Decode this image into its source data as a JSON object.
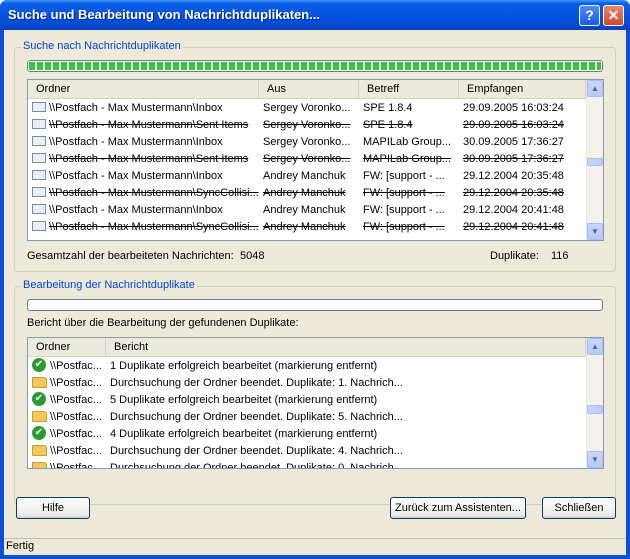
{
  "window": {
    "title": "Suche und Bearbeitung von Nachrichtduplikaten...",
    "help_glyph": "?",
    "close_glyph": "✕"
  },
  "search_group": {
    "legend": "Suche nach Nachrichtduplikaten",
    "progress_fraction": 1.0,
    "columns": [
      "Ordner",
      "Aus",
      "Betreff",
      "Empfangen"
    ],
    "rows": [
      {
        "folder": "\\\\Postfach - Max Mustermann\\Inbox",
        "from": "Sergey Voronko...",
        "subject": "SPE 1.8.4",
        "received": "29.09.2005 16:03:24",
        "duplicate": false
      },
      {
        "folder": "\\\\Postfach - Max Mustermann\\Sent Items",
        "from": "Sergey Voronko...",
        "subject": "SPE 1.8.4",
        "received": "29.09.2005 16:03:24",
        "duplicate": true
      },
      {
        "folder": "\\\\Postfach - Max Mustermann\\Inbox",
        "from": "Sergey Voronko...",
        "subject": "MAPILab Group...",
        "received": "30.09.2005 17:36:27",
        "duplicate": false
      },
      {
        "folder": "\\\\Postfach - Max Mustermann\\Sent Items",
        "from": "Sergey Voronko...",
        "subject": "MAPILab Group...",
        "received": "30.09.2005 17:36:27",
        "duplicate": true
      },
      {
        "folder": "\\\\Postfach - Max Mustermann\\Inbox",
        "from": "Andrey Manchuk",
        "subject": "FW: [support - ...",
        "received": "29.12.2004 20:35:48",
        "duplicate": false
      },
      {
        "folder": "\\\\Postfach - Max Mustermann\\SyncCollisi...",
        "from": "Andrey Manchuk",
        "subject": "FW: [support - ...",
        "received": "29.12.2004 20:35:48",
        "duplicate": true
      },
      {
        "folder": "\\\\Postfach - Max Mustermann\\Inbox",
        "from": "Andrey Manchuk",
        "subject": "FW: [support - ...",
        "received": "29.12.2004 20:41:48",
        "duplicate": false
      },
      {
        "folder": "\\\\Postfach - Max Mustermann\\SyncCollisi...",
        "from": "Andrey Manchuk",
        "subject": "FW: [support - ...",
        "received": "29.12.2004 20:41:48",
        "duplicate": true
      }
    ],
    "total_label": "Gesamtzahl der bearbeiteten Nachrichten:",
    "total_value": "5048",
    "duplicates_label": "Duplikate:",
    "duplicates_value": "116"
  },
  "processing_group": {
    "legend": "Bearbeitung der Nachrichtduplikate",
    "progress_fraction": 0.0,
    "report_label": "Bericht über die Bearbeitung der gefundenen Duplikate:",
    "columns": [
      "Ordner",
      "Bericht"
    ],
    "rows": [
      {
        "icon": "check-icon",
        "folder": "\\\\Postfac...",
        "report": "1 Duplikate erfolgreich bearbeitet (markierung entfernt)"
      },
      {
        "icon": "folder-icon",
        "folder": "\\\\Postfac...",
        "report": "Durchsuchung der Ordner beendet. Duplikate: 1. Nachrich..."
      },
      {
        "icon": "check-icon",
        "folder": "\\\\Postfac...",
        "report": "5 Duplikate erfolgreich bearbeitet (markierung entfernt)"
      },
      {
        "icon": "folder-icon",
        "folder": "\\\\Postfac...",
        "report": "Durchsuchung der Ordner beendet. Duplikate: 5. Nachrich..."
      },
      {
        "icon": "check-icon",
        "folder": "\\\\Postfac...",
        "report": "4 Duplikate erfolgreich bearbeitet (markierung entfernt)"
      },
      {
        "icon": "folder-icon",
        "folder": "\\\\Postfac...",
        "report": "Durchsuchung der Ordner beendet. Duplikate: 4. Nachrich..."
      },
      {
        "icon": "folder-icon",
        "folder": "\\\\Postfac...",
        "report": "Durchsuchung der Ordner beendet. Duplikate: 0. Nachrich..."
      }
    ]
  },
  "buttons": {
    "help": "Hilfe",
    "back": "Zurück zum Assistenten...",
    "close": "Schließen"
  },
  "status": {
    "text": "Fertig"
  },
  "colors": {
    "title_bar": "#0553e1",
    "group_legend": "#0046d5",
    "progress_green": "#36c43a"
  }
}
